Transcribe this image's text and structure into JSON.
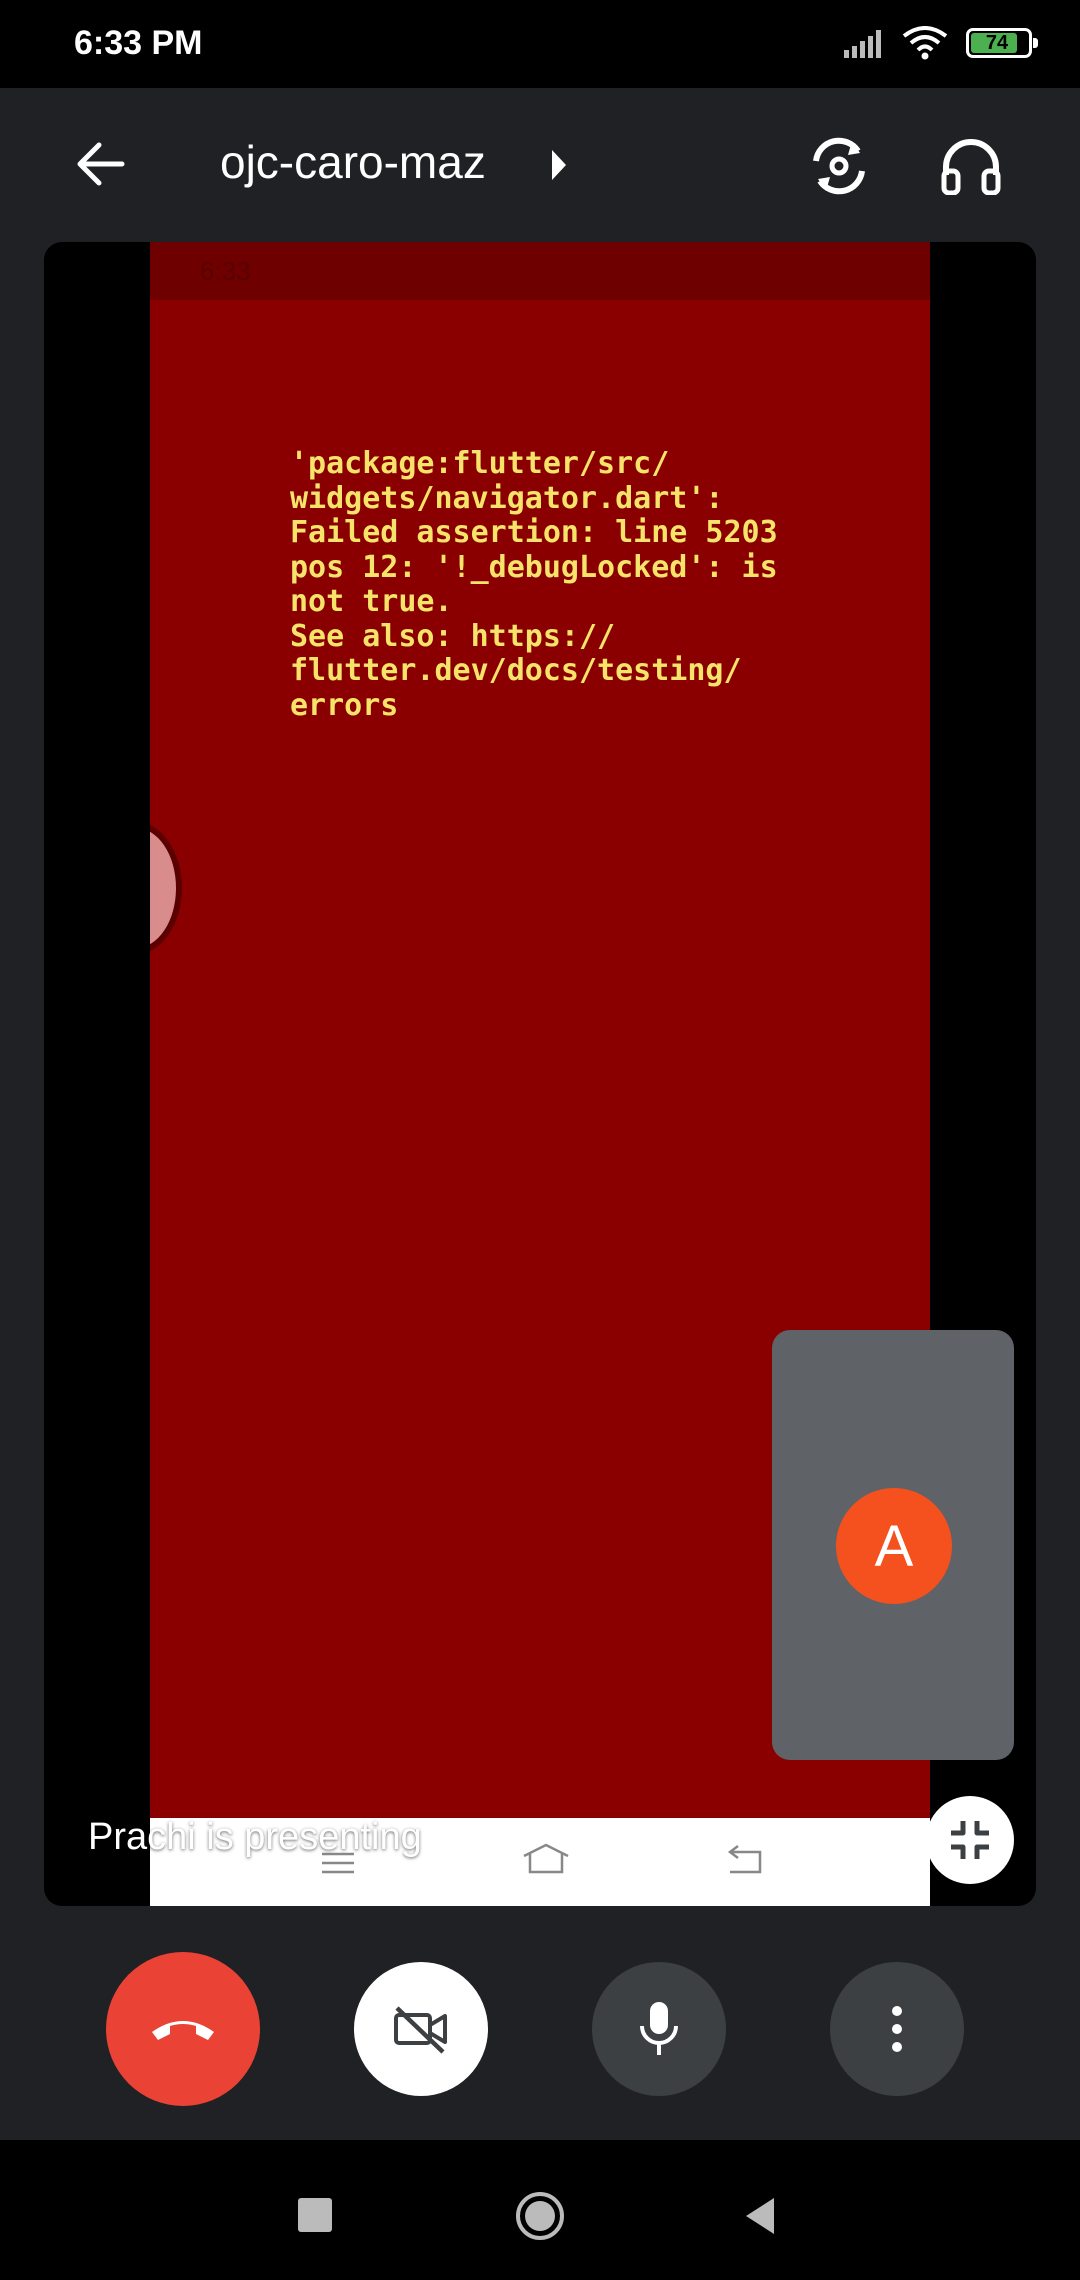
{
  "status_bar": {
    "time": "6:33 PM",
    "battery": "74"
  },
  "header": {
    "meeting_code": "ojc-caro-maz"
  },
  "shared_screen": {
    "status_time": "6:33",
    "error_message": "'package:flutter/src/\nwidgets/navigator.dart':\nFailed assertion: line 5203\npos 12: '!_debugLocked': is\nnot true.\nSee also: https://\nflutter.dev/docs/testing/\nerrors"
  },
  "presenter_label": "Prachi is presenting",
  "self_tile": {
    "avatar_letter": "A",
    "avatar_color": "#f4511e"
  },
  "colors": {
    "end_call": "#ea4335",
    "shared_bg": "#8a0000",
    "error_text": "#f5e36a"
  }
}
